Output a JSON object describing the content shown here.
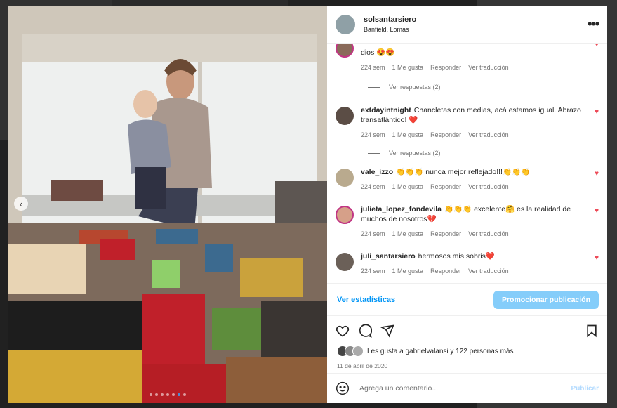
{
  "post": {
    "username": "solsantarsiero",
    "location": "Banfield, Lomas",
    "carousel_total": 7,
    "carousel_active": 6
  },
  "comments": [
    {
      "user": "",
      "text": "dios 😍😍",
      "time": "224 sem",
      "likes": "1 Me gusta",
      "reply": "Responder",
      "translate": "Ver traducción",
      "replies": "Ver respuestas (2)",
      "avatar_color": "#8a6a5a"
    },
    {
      "user": "extdayintnight",
      "text": "Chancletas con medias, acá estamos igual. Abrazo transatlántico! ❤️",
      "time": "224 sem",
      "likes": "1 Me gusta",
      "reply": "Responder",
      "translate": "Ver traducción",
      "replies": "Ver respuestas (2)",
      "avatar_color": "#5b4d45"
    },
    {
      "user": "vale_izzo",
      "text": "👏👏👏 nunca mejor reflejado!!!👏👏👏",
      "time": "224 sem",
      "likes": "1 Me gusta",
      "reply": "Responder",
      "translate": "Ver traducción",
      "avatar_color": "#b9aa8e"
    },
    {
      "user": "julieta_lopez_fondevila",
      "text": "👏👏👏 excelente🤗 es la realidad de muchos de nosotros💔",
      "time": "224 sem",
      "likes": "1 Me gusta",
      "reply": "Responder",
      "translate": "Ver traducción",
      "avatar_color": "#d6a089"
    },
    {
      "user": "juli_santarsiero",
      "text": "hermosos mis sobris❤️",
      "time": "224 sem",
      "likes": "1 Me gusta",
      "reply": "Responder",
      "translate": "Ver traducción",
      "avatar_color": "#6b6058"
    }
  ],
  "stats_link": "Ver estadísticas",
  "promote_button": "Promocionar publicación",
  "likes_text": "Les gusta a gabrielvalansi y 122 personas más",
  "date": "11 de abril de 2020",
  "comment_placeholder": "Agrega un comentario...",
  "publish": "Publicar",
  "icons": {
    "like": "heart-outline-icon",
    "comment": "speech-bubble-icon",
    "share": "paper-plane-icon",
    "save": "bookmark-icon",
    "emoji": "smiley-icon",
    "more": "ellipsis-icon",
    "prev": "chevron-left-icon"
  },
  "colors": {
    "link": "#0095f6",
    "promote_bg": "#85cdfa",
    "heart": "#ed4956",
    "publish_disabled": "#b3dbff"
  }
}
